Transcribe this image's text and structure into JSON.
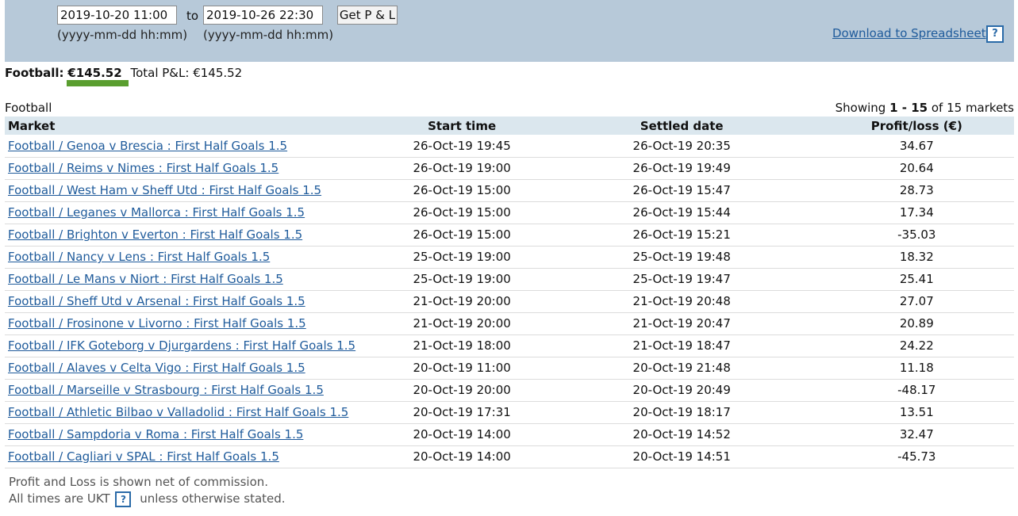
{
  "filter": {
    "from_value": "2019-10-20 11:00",
    "to_label": "to",
    "to_value": "2019-10-26 22:30",
    "get_button": "Get P & L",
    "from_hint": "(yyyy-mm-dd hh:mm)",
    "to_hint": "(yyyy-mm-dd hh:mm)"
  },
  "download": {
    "label": "Download to Spreadsheet",
    "help": "?"
  },
  "summary": {
    "sport_label": "Football:",
    "sport_amount": "€145.52",
    "total_label": "Total P&L:",
    "total_amount": "€145.52",
    "bar_color": "#5a9e2f"
  },
  "section": {
    "label": "Football"
  },
  "showing": {
    "prefix": "Showing",
    "range": "1 - 15",
    "suffix": "of 15 markets"
  },
  "table": {
    "headers": [
      "Market",
      "Start time",
      "Settled date",
      "Profit/loss (€)"
    ],
    "rows": [
      {
        "market": "Football / Genoa v Brescia : First Half Goals 1.5",
        "start": "26-Oct-19 19:45",
        "settled": "26-Oct-19 20:35",
        "pl": "34.67"
      },
      {
        "market": "Football / Reims v Nimes : First Half Goals 1.5",
        "start": "26-Oct-19 19:00",
        "settled": "26-Oct-19 19:49",
        "pl": "20.64"
      },
      {
        "market": "Football / West Ham v Sheff Utd : First Half Goals 1.5",
        "start": "26-Oct-19 15:00",
        "settled": "26-Oct-19 15:47",
        "pl": "28.73"
      },
      {
        "market": "Football / Leganes v Mallorca : First Half Goals 1.5",
        "start": "26-Oct-19 15:00",
        "settled": "26-Oct-19 15:44",
        "pl": "17.34"
      },
      {
        "market": "Football / Brighton v Everton : First Half Goals 1.5",
        "start": "26-Oct-19 15:00",
        "settled": "26-Oct-19 15:21",
        "pl": "-35.03"
      },
      {
        "market": "Football / Nancy v Lens : First Half Goals 1.5",
        "start": "25-Oct-19 19:00",
        "settled": "25-Oct-19 19:48",
        "pl": "18.32"
      },
      {
        "market": "Football / Le Mans v Niort : First Half Goals 1.5",
        "start": "25-Oct-19 19:00",
        "settled": "25-Oct-19 19:47",
        "pl": "25.41"
      },
      {
        "market": "Football / Sheff Utd v Arsenal : First Half Goals 1.5",
        "start": "21-Oct-19 20:00",
        "settled": "21-Oct-19 20:48",
        "pl": "27.07"
      },
      {
        "market": "Football / Frosinone v Livorno : First Half Goals 1.5",
        "start": "21-Oct-19 20:00",
        "settled": "21-Oct-19 20:47",
        "pl": "20.89"
      },
      {
        "market": "Football / IFK Goteborg v Djurgardens : First Half Goals 1.5",
        "start": "21-Oct-19 18:00",
        "settled": "21-Oct-19 18:47",
        "pl": "24.22"
      },
      {
        "market": "Football / Alaves v Celta Vigo : First Half Goals 1.5",
        "start": "20-Oct-19 11:00",
        "settled": "20-Oct-19 21:48",
        "pl": "11.18"
      },
      {
        "market": "Football / Marseille v Strasbourg : First Half Goals 1.5",
        "start": "20-Oct-19 20:00",
        "settled": "20-Oct-19 20:49",
        "pl": "-48.17"
      },
      {
        "market": "Football / Athletic Bilbao v Valladolid : First Half Goals 1.5",
        "start": "20-Oct-19 17:31",
        "settled": "20-Oct-19 18:17",
        "pl": "13.51"
      },
      {
        "market": "Football / Sampdoria v Roma : First Half Goals 1.5",
        "start": "20-Oct-19 14:00",
        "settled": "20-Oct-19 14:52",
        "pl": "32.47"
      },
      {
        "market": "Football / Cagliari v SPAL : First Half Goals 1.5",
        "start": "20-Oct-19 14:00",
        "settled": "20-Oct-19 14:51",
        "pl": "-45.73"
      }
    ]
  },
  "footer": {
    "line1": "Profit and Loss is shown net of commission.",
    "line2_prefix": "All times are UKT",
    "help": "?",
    "line2_suffix": "unless otherwise stated."
  }
}
